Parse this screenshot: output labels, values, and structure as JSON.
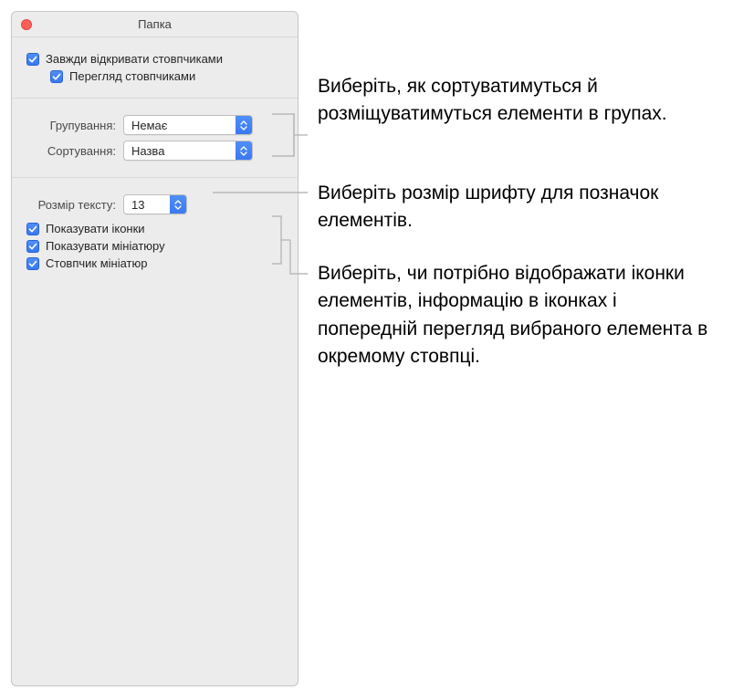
{
  "window": {
    "title": "Папка"
  },
  "section1": {
    "always_open_columns": "Завжди відкривати стовпчиками",
    "browse_columns": "Перегляд стовпчиками"
  },
  "section2": {
    "group_label": "Групування:",
    "group_value": "Немає",
    "sort_label": "Сортування:",
    "sort_value": "Назва"
  },
  "section3": {
    "textsize_label": "Розмір тексту:",
    "textsize_value": "13",
    "show_icons": "Показувати іконки",
    "show_thumb": "Показувати мініатюру",
    "thumb_column": "Стовпчик мініатюр"
  },
  "callouts": {
    "c1": "Виберіть, як сортуватимуться й розміщуватимуться елементи в групах.",
    "c2": "Виберіть розмір шрифту для позначок елементів.",
    "c3": "Виберіть, чи потрібно відображати іконки елементів, інформацію в іконках і попередній перегляд вибраного елемента в окремому стовпці."
  }
}
